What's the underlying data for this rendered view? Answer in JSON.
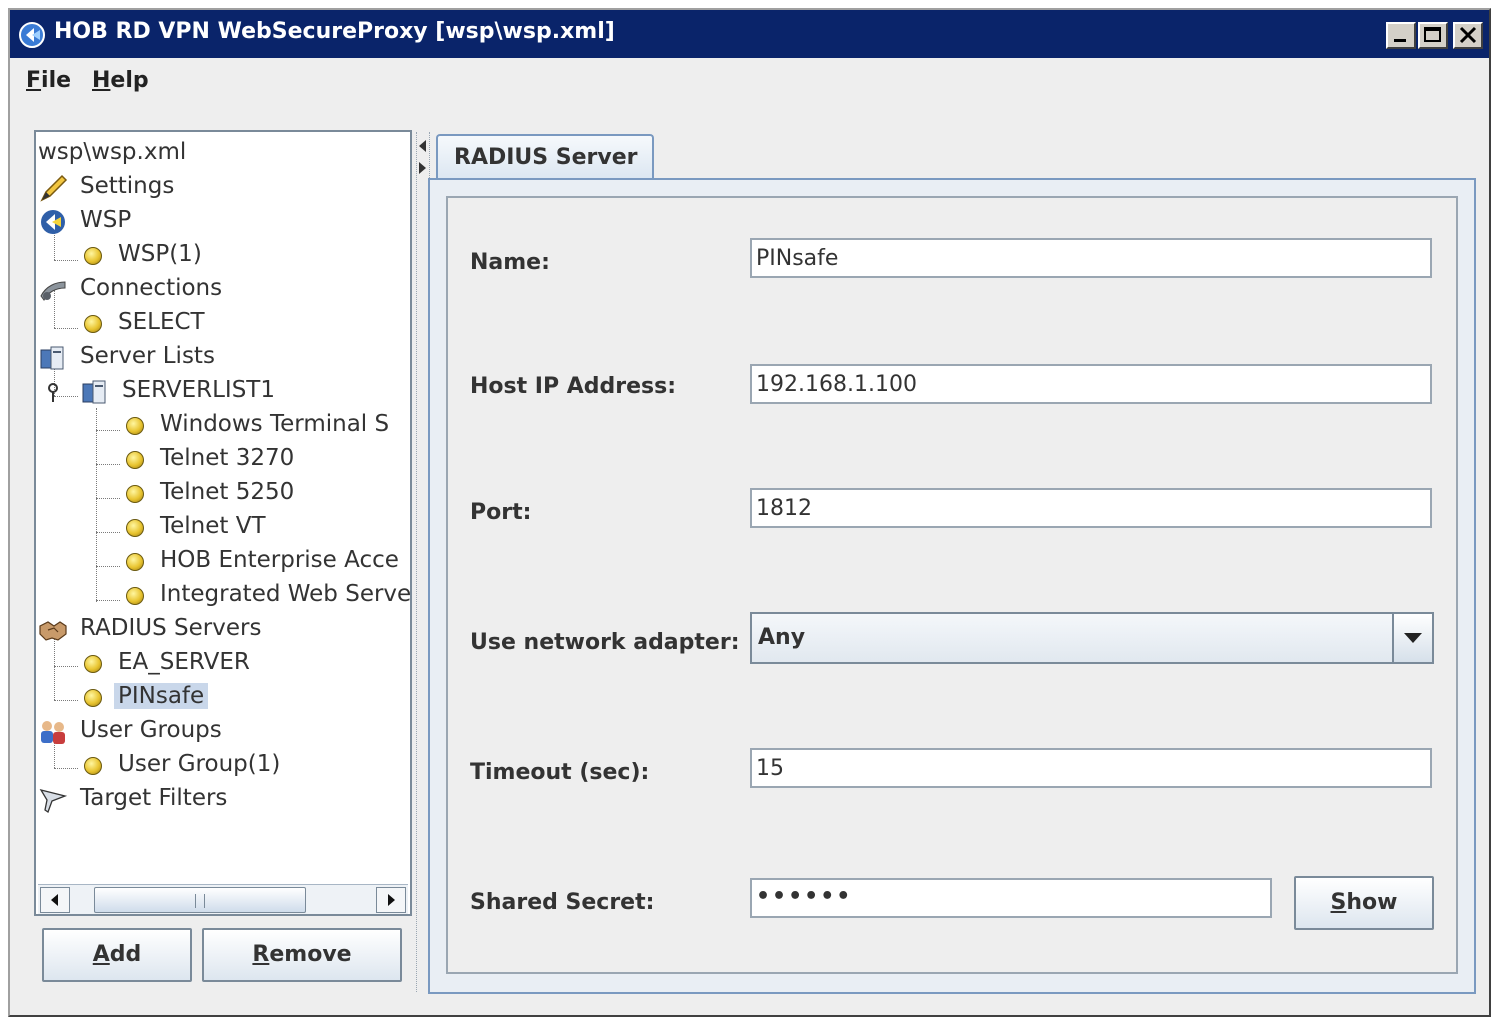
{
  "window": {
    "title": "HOB RD VPN WebSecureProxy [wsp\\wsp.xml]"
  },
  "menu": {
    "file_mnemonic": "F",
    "file_rest": "ile",
    "help_mnemonic": "H",
    "help_rest": "elp"
  },
  "tree": {
    "root": "wsp\\wsp.xml",
    "settings": "Settings",
    "wsp": "WSP",
    "wsp_item": "WSP(1)",
    "connections": "Connections",
    "connections_item": "SELECT",
    "server_lists": "Server Lists",
    "serverlist1": "SERVERLIST1",
    "servers": [
      "Windows Terminal S",
      "Telnet 3270",
      "Telnet 5250",
      "Telnet VT",
      "HOB Enterprise Acce",
      "Integrated Web Serve"
    ],
    "radius_servers": "RADIUS Servers",
    "radius_items": [
      "EA_SERVER",
      "PINsafe"
    ],
    "user_groups": "User Groups",
    "user_group_item": "User Group(1)",
    "target_filters": "Target Filters"
  },
  "buttons": {
    "add_mnemonic": "A",
    "add_rest": "dd",
    "remove_mnemonic": "R",
    "remove_rest": "emove",
    "show_mnemonic": "S",
    "show_rest": "how"
  },
  "tab": {
    "label": "RADIUS Server"
  },
  "form": {
    "name_label": "Name:",
    "name_value": "PINsafe",
    "host_label": "Host IP Address:",
    "host_value": "192.168.1.100",
    "port_label": "Port:",
    "port_value": "1812",
    "adapter_label": "Use network adapter:",
    "adapter_value": "Any",
    "timeout_label": "Timeout (sec):",
    "timeout_value": "15",
    "secret_label": "Shared Secret:",
    "secret_value": "••••••"
  },
  "colors": {
    "titlebar": "#0a246a",
    "selection": "#c9d7ea",
    "tab_border": "#7a99c0"
  }
}
